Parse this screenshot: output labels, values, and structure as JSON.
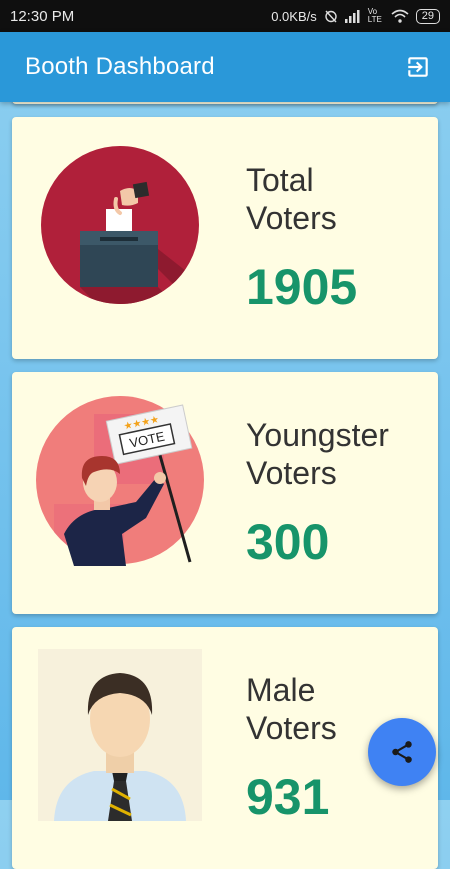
{
  "status_bar": {
    "time": "12:30 PM",
    "network_speed": "0.0KB/s",
    "network_type": "Vo LTE",
    "battery": "29"
  },
  "app_bar": {
    "title": "Booth Dashboard",
    "exit_icon": "exit-to-app-icon"
  },
  "cards": [
    {
      "label_line1": "Total",
      "label_line2": "Voters",
      "value": "1905",
      "art": "ballot-box"
    },
    {
      "label_line1": "Youngster",
      "label_line2": "Voters",
      "value": "300",
      "art": "vote-sign",
      "sign_text": "VOTE"
    },
    {
      "label_line1": "Male",
      "label_line2": "Voters",
      "value": "931",
      "art": "male-avatar"
    }
  ],
  "fab": {
    "icon": "share-icon"
  },
  "colors": {
    "app_bar": "#2a98d9",
    "card_bg": "#fffde3",
    "value_green": "#17946a",
    "fab": "#3f82f3"
  }
}
